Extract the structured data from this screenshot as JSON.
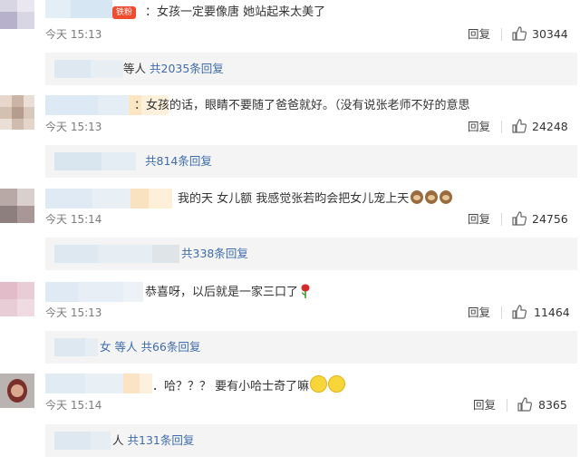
{
  "comments": [
    {
      "text": "：女孩一定要像唐 她站起来太美了",
      "badge": "铁粉",
      "time": "今天 15:13",
      "reply_label": "回复",
      "likes": "30344",
      "thread_prefix": "等人",
      "thread_link": "共2035条回复"
    },
    {
      "text": "：女孩的话，眼睛不要随了爸爸就好。（没有说张老师不好的意思",
      "time": "今天 15:13",
      "reply_label": "回复",
      "likes": "24248",
      "thread_link": "共814条回复"
    },
    {
      "text": "我的天 女儿额 我感觉张若昀会把女儿宠上天",
      "time": "今天 15:14",
      "reply_label": "回复",
      "likes": "24756",
      "thread_link": "共338条回复"
    },
    {
      "text": "恭喜呀，以后就是一家三口了",
      "time": "今天 15:13",
      "reply_label": "回复",
      "likes": "11464",
      "thread_prefix": "女 等人",
      "thread_link": "共66条回复"
    },
    {
      "text": "．哈？？？ 要有小哈士奇了嘛",
      "time": "今天 15:14",
      "reply_label": "回复",
      "likes": "8365",
      "thread_prefix": "人",
      "thread_link": "共131条回复"
    }
  ]
}
